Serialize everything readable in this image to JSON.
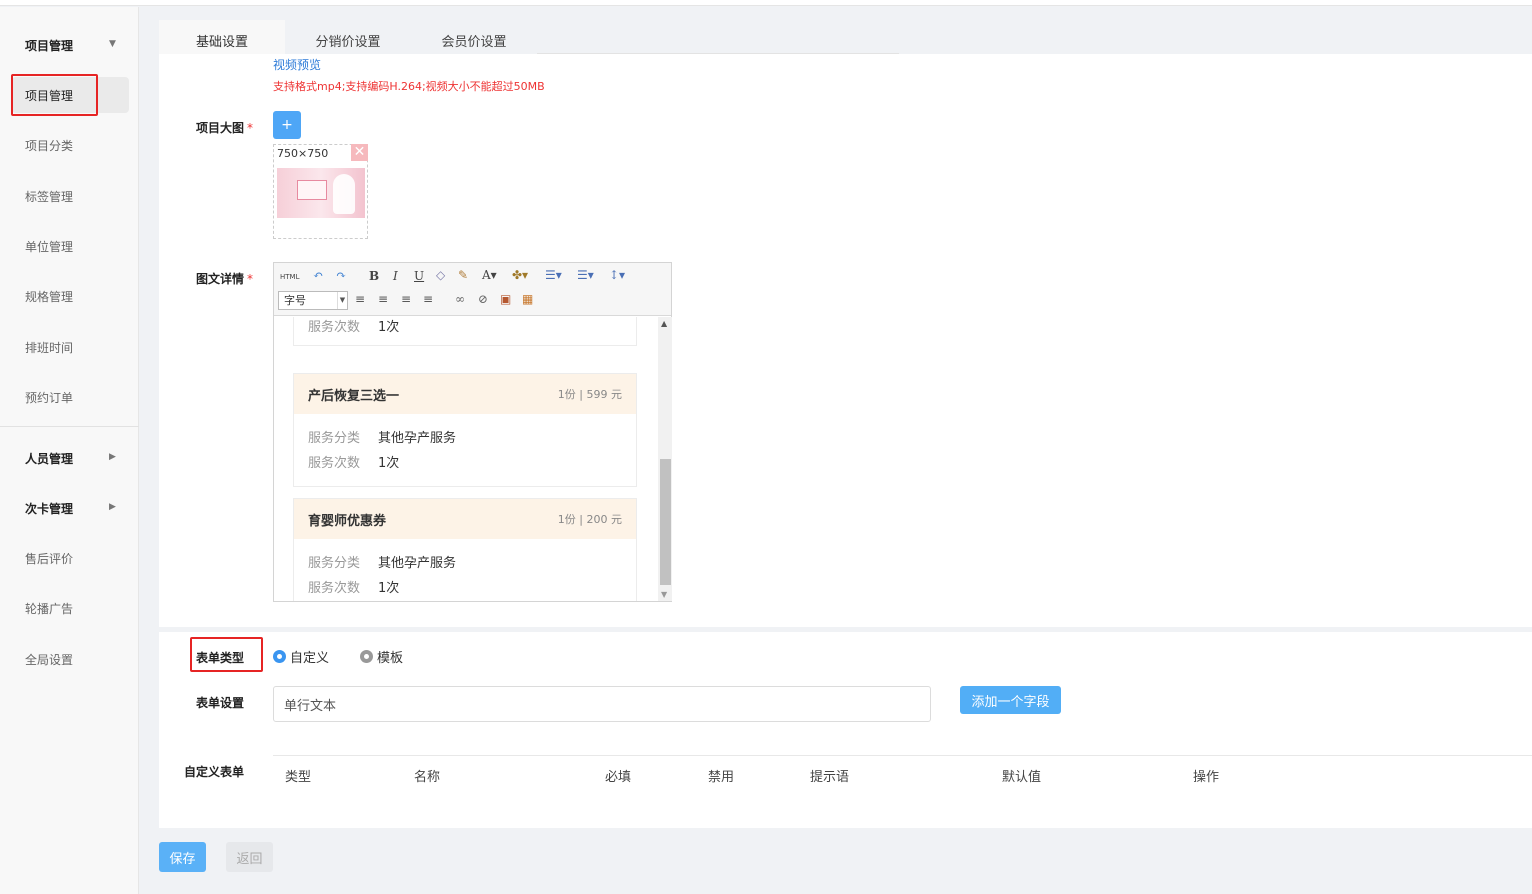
{
  "sidebar": {
    "groups": [
      {
        "label": "项目管理",
        "arrow": "▼"
      },
      {
        "label": "人员管理",
        "arrow": "▶"
      },
      {
        "label": "次卡管理",
        "arrow": "▶"
      }
    ],
    "items": [
      {
        "label": "项目管理"
      },
      {
        "label": "项目分类"
      },
      {
        "label": "标签管理"
      },
      {
        "label": "单位管理"
      },
      {
        "label": "规格管理"
      },
      {
        "label": "排班时间"
      },
      {
        "label": "预约订单"
      },
      {
        "label": "售后评价"
      },
      {
        "label": "轮播广告"
      },
      {
        "label": "全局设置"
      }
    ]
  },
  "tabs": [
    {
      "label": "基础设置"
    },
    {
      "label": "分销价设置"
    },
    {
      "label": "会员价设置"
    }
  ],
  "video": {
    "preview_link": "视频预览",
    "hint": "支持格式mp4;支持编码H.264;视频大小不能超过50MB"
  },
  "main_image": {
    "label": "项目大图",
    "required_mark": "*",
    "add_button": "+",
    "size_text": "750×750",
    "close_glyph": "✕"
  },
  "detail": {
    "label": "图文详情",
    "required_mark": "*",
    "font_size_select": "字号",
    "toolbar_html": "HTML",
    "services": [
      {
        "name": "",
        "price": "",
        "rows": [
          {
            "key": "服务次数",
            "value": "1次"
          }
        ]
      },
      {
        "name": "产后恢复三选一",
        "price": "1份 | 599 元",
        "rows": [
          {
            "key": "服务分类",
            "value": "其他孕产服务"
          },
          {
            "key": "服务次数",
            "value": "1次"
          }
        ]
      },
      {
        "name": "育婴师优惠券",
        "price": "1份 | 200 元",
        "rows": [
          {
            "key": "服务分类",
            "value": "其他孕产服务"
          },
          {
            "key": "服务次数",
            "value": "1次"
          }
        ]
      }
    ]
  },
  "form_type": {
    "label": "表单类型",
    "options": [
      {
        "label": "自定义",
        "selected": true
      },
      {
        "label": "模板",
        "selected": false
      }
    ]
  },
  "form_settings": {
    "label": "表单设置",
    "input_value": "单行文本",
    "add_field_button": "添加一个字段"
  },
  "custom_form": {
    "label": "自定义表单",
    "columns": [
      "类型",
      "名称",
      "必填",
      "禁用",
      "提示语",
      "默认值",
      "操作"
    ]
  },
  "footer": {
    "save": "保存",
    "back": "返回"
  },
  "colors": {
    "accent": "#4ea6f6",
    "highlight_box": "#e62424"
  }
}
